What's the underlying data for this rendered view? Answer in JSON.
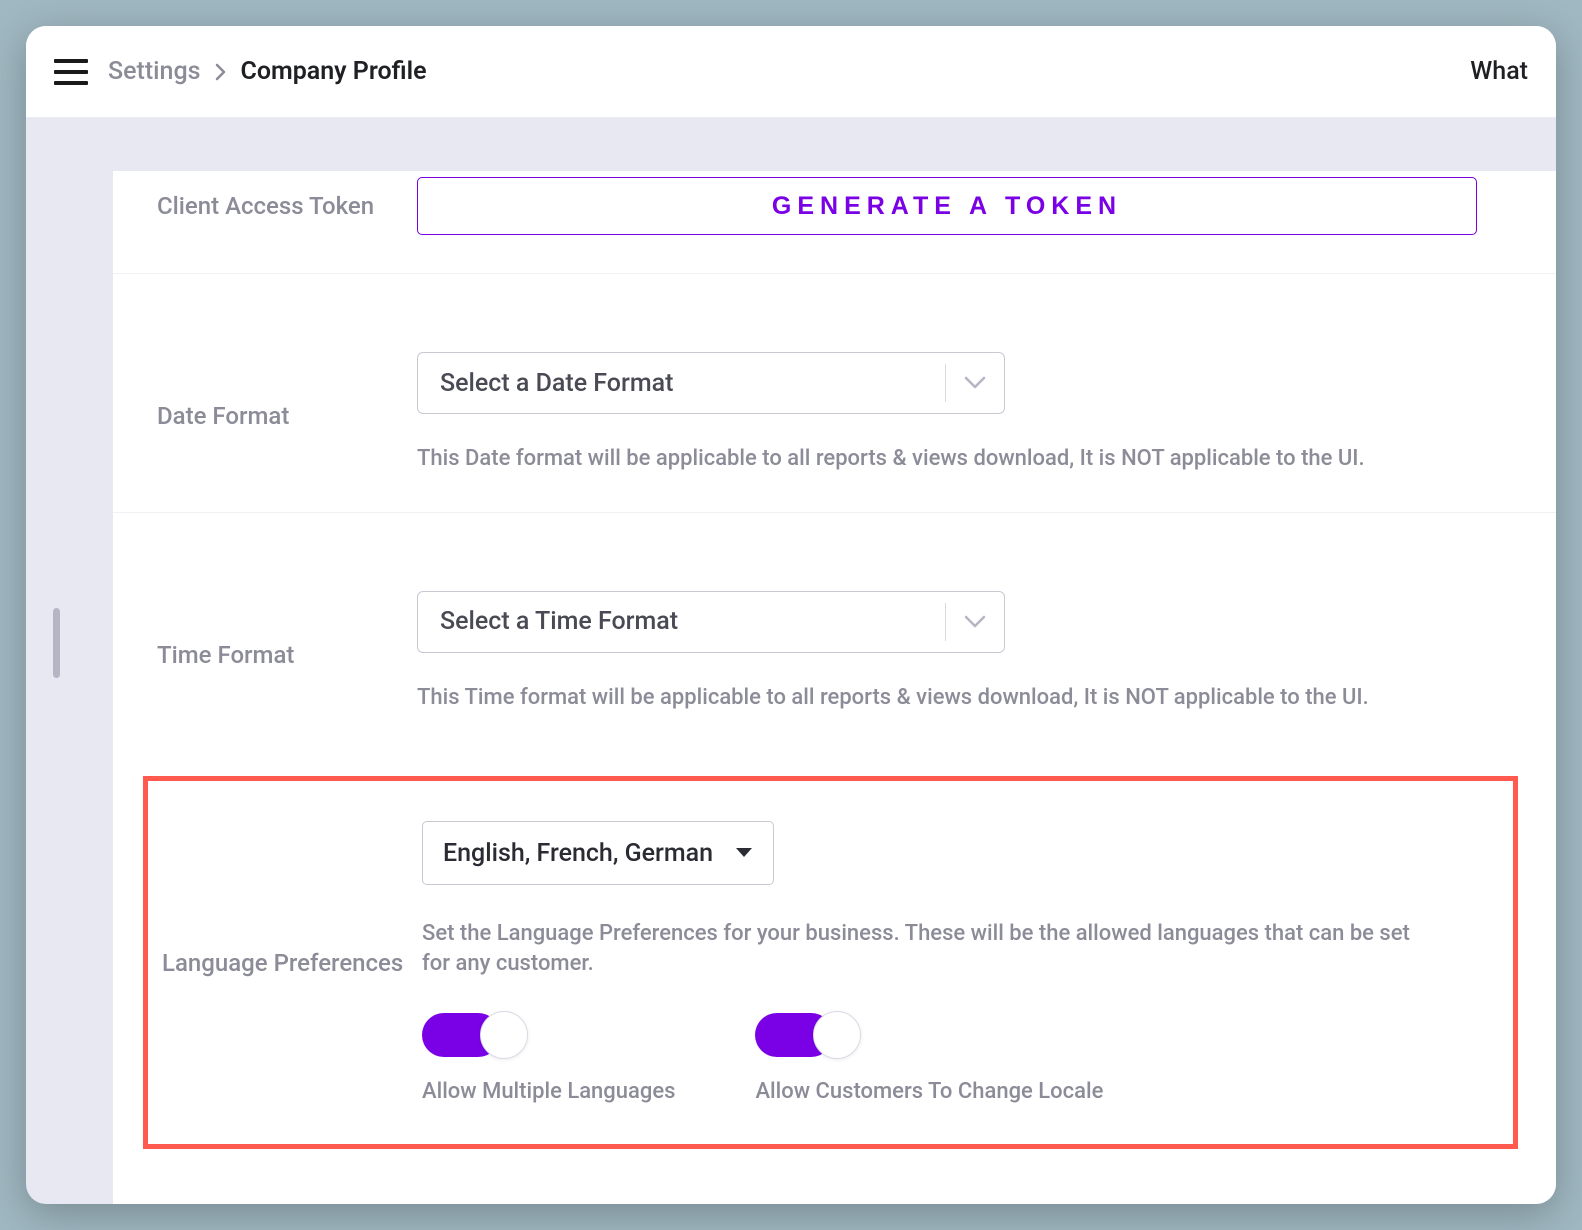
{
  "breadcrumb": {
    "parent": "Settings",
    "current": "Company Profile"
  },
  "header": {
    "right_link": "What"
  },
  "token": {
    "label": "Client Access Token",
    "button": "GENERATE A TOKEN"
  },
  "date_format": {
    "label": "Date Format",
    "placeholder": "Select a Date Format",
    "helper": "This Date format will be applicable to all reports & views download, It is NOT applicable to the UI."
  },
  "time_format": {
    "label": "Time Format",
    "placeholder": "Select a Time Format",
    "helper": "This Time format will be applicable to all reports & views download, It is NOT applicable to the UI."
  },
  "language": {
    "label": "Language Preferences",
    "selected": "English, French, German",
    "helper": "Set the Language Preferences for your business. These will be the allowed languages that can be set for any customer.",
    "toggle_multi_label": "Allow Multiple Languages",
    "toggle_locale_label": "Allow Customers To Change Locale"
  },
  "colors": {
    "accent": "#7a00e6",
    "highlight_border": "#ff5a4d"
  }
}
